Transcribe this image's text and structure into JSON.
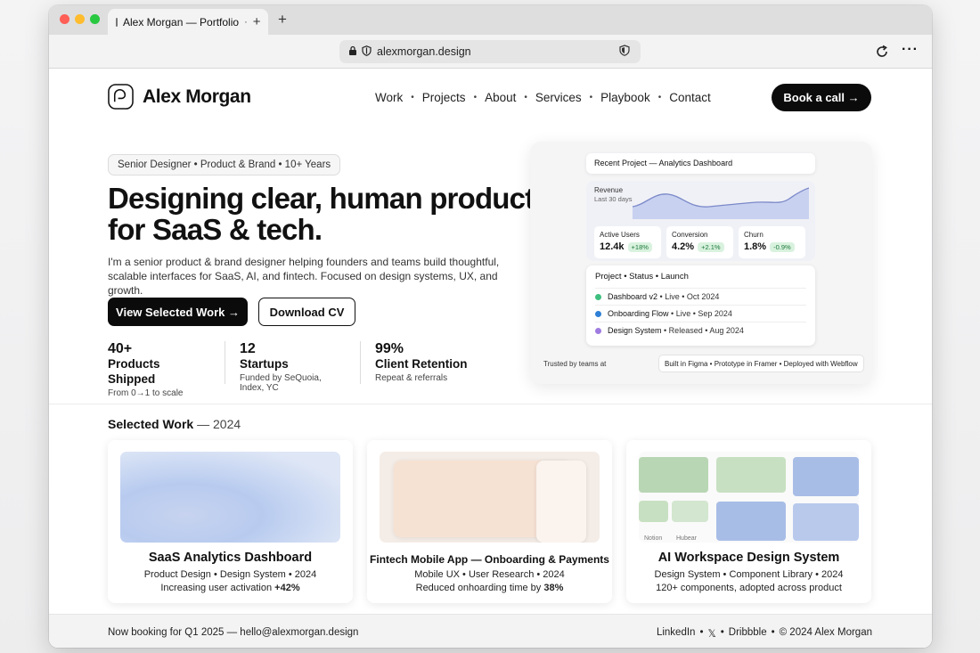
{
  "browser": {
    "tab_title": "Alex Morgan — Portfolio",
    "tab_close": "·",
    "new_tab": "+",
    "url": "alexmorgan.design",
    "more": "···",
    "traffic_lights": [
      "#fe5f57",
      "#febc2e",
      "#28c840"
    ]
  },
  "header": {
    "brand_name": "Alex Morgan",
    "nav": [
      "Work",
      "Projects",
      "About",
      "Services",
      "Playbook",
      "Contact"
    ],
    "nav_separator": "•",
    "cta": "Book a call →"
  },
  "hero": {
    "tagline": "Senior Designer • Product & Brand • 10+ Years",
    "headline": "Designing clear, human products for SaaS & tech.",
    "subhead": "I'm a senior product & brand designer helping founders and teams build thoughtful, scalable interfaces for SaaS, AI, and fintech. Focused on design systems, UX, and growth.",
    "primary_button": "View Selected Work →",
    "secondary_button": "Download CV",
    "stats": [
      {
        "value": "40+",
        "label": "Products Shipped",
        "note": "From 0→1 to scale"
      },
      {
        "value": "12",
        "label": "Startups",
        "note": "Funded by SeQuoia, Index, YC"
      },
      {
        "value": "99%",
        "label": "Client Retention",
        "note": "Repeat & referrals"
      }
    ]
  },
  "preview": {
    "title": "Recent Project — Analytics Dashboard",
    "revenue_label": "Revenue",
    "revenue_period": "Last 30 days",
    "metrics": [
      {
        "label": "Active Users",
        "value": "12.4k",
        "delta": "+18%"
      },
      {
        "label": "Conversion",
        "value": "4.2%",
        "delta": "+2.1%"
      },
      {
        "label": "Churn",
        "value": "1.8%",
        "delta": "-0.9%"
      }
    ],
    "table_header": "Project • Status • Launch",
    "rows": [
      {
        "name": "Dashboard v2",
        "status": " • Live • Oct 2024",
        "color": "#3fbf7f"
      },
      {
        "name": "Onboarding Flow",
        "status": " • Live • Sep 2024",
        "color": "#2f80d6"
      },
      {
        "name": "Design System",
        "status": " • Released • Aug 2024",
        "color": "#a07ce0"
      }
    ],
    "trusted": "Trusted by teams at",
    "tools": "Built in Figma • Prototype in Framer • Deployed with Webflow"
  },
  "work": {
    "title": "Selected Work",
    "year": " — 2024",
    "cards": [
      {
        "title": "SaaS Analytics Dashboard",
        "meta": "Product Design • Design System • 2024",
        "result": "Increasing user activation ",
        "result_strong": "+42%"
      },
      {
        "title": "Fintech Mobile App — Onboarding & Payments",
        "meta": "Mobile UX • User Research • 2024",
        "result": "Reduced onhoarding time by ",
        "result_strong": "38%"
      },
      {
        "title": "AI Workspace Design System",
        "meta": "Design System • Component Library • 2024",
        "result": "120+ components, adopted across product",
        "result_strong": ""
      }
    ],
    "visual3_labels": [
      "Notion",
      "Hubear"
    ]
  },
  "footer": {
    "left": "Now booking for Q1 2025 — hello@alexmorgan.design",
    "links": [
      "LinkedIn",
      "•",
      "𝕏",
      "•",
      "Dribbble",
      "•",
      "© 2024 Alex Morgan"
    ]
  }
}
